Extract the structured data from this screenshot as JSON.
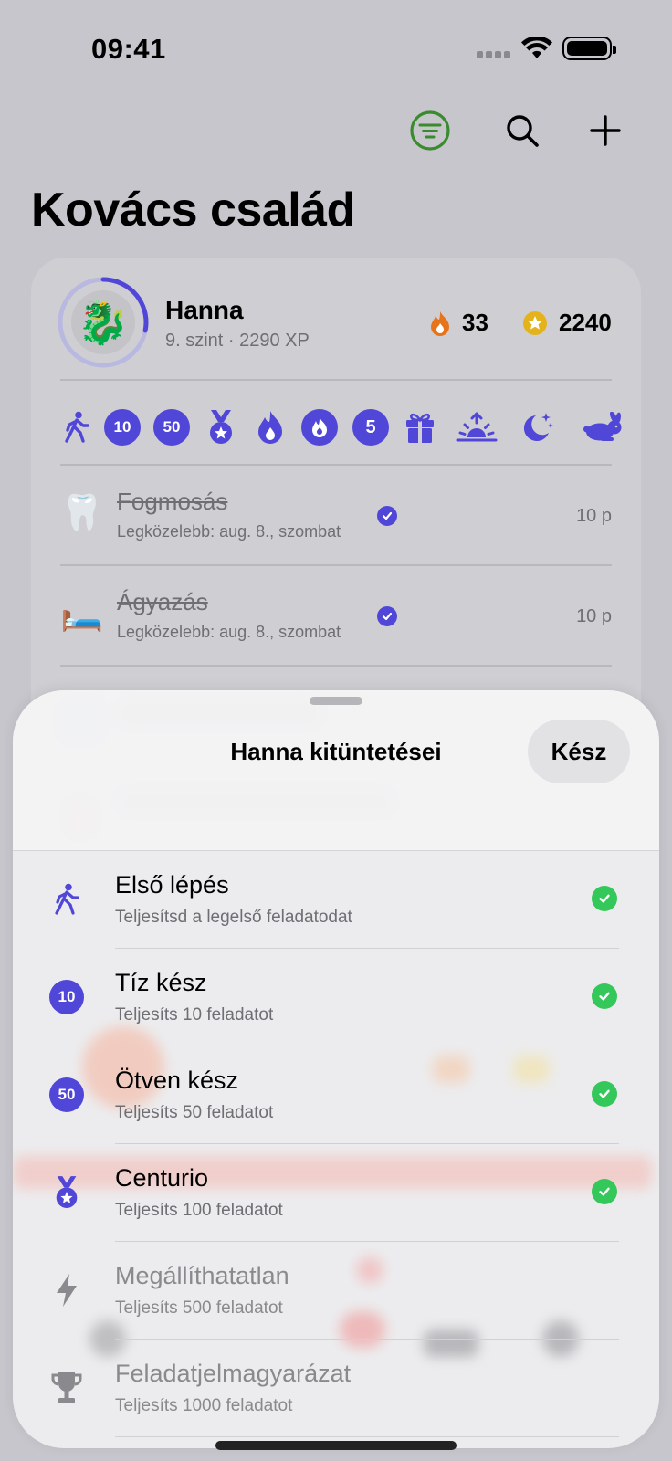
{
  "status_bar": {
    "time": "09:41"
  },
  "toolbar": {
    "filter_icon": "filter-circle-icon",
    "search_icon": "search-icon",
    "add_icon": "plus-icon"
  },
  "page": {
    "title": "Kovács család"
  },
  "member": {
    "name": "Hanna",
    "subtitle": "9. szint · 2290 XP",
    "level_progress": 0.28,
    "streak": "33",
    "points": "2240",
    "avatar": "🐉"
  },
  "badges": [
    {
      "icon": "walking-icon",
      "label": ""
    },
    {
      "icon": "ten-badge-icon",
      "label": "10"
    },
    {
      "icon": "fifty-badge-icon",
      "label": "50"
    },
    {
      "icon": "medal-icon",
      "label": ""
    },
    {
      "icon": "flame-icon",
      "label": ""
    },
    {
      "icon": "flame-circle-icon",
      "label": ""
    },
    {
      "icon": "five-badge-icon",
      "label": "5"
    },
    {
      "icon": "gift-icon",
      "label": ""
    },
    {
      "icon": "sunrise-icon",
      "label": ""
    },
    {
      "icon": "moon-stars-icon",
      "label": ""
    },
    {
      "icon": "rabbit-icon",
      "label": ""
    }
  ],
  "tasks": [
    {
      "emoji": "🦷",
      "name": "Fogmosás",
      "due": "Legközelebb: aug. 8., szombat",
      "points": "10 p",
      "done": true
    },
    {
      "emoji": "🛏️",
      "name": "Ágyazás",
      "due": "Legközelebb: aug. 8., szombat",
      "points": "10 p",
      "done": true
    }
  ],
  "sheet": {
    "title": "Hanna kitüntetései",
    "done_label": "Kész",
    "items": [
      {
        "icon": "walking-icon",
        "badge_text": "",
        "title": "Első lépés",
        "subtitle": "Teljesítsd a legelső feladatodat",
        "earned": true
      },
      {
        "icon": "ten-badge-icon",
        "badge_text": "10",
        "title": "Tíz kész",
        "subtitle": "Teljesíts 10 feladatot",
        "earned": true
      },
      {
        "icon": "fifty-badge-icon",
        "badge_text": "50",
        "title": "Ötven kész",
        "subtitle": "Teljesíts 50 feladatot",
        "earned": true
      },
      {
        "icon": "medal-icon",
        "badge_text": "",
        "title": "Centurio",
        "subtitle": "Teljesíts 100 feladatot",
        "earned": true
      },
      {
        "icon": "bolt-icon",
        "badge_text": "",
        "title": "Megállíthatatlan",
        "subtitle": "Teljesíts 500 feladatot",
        "earned": false
      },
      {
        "icon": "trophy-icon",
        "badge_text": "",
        "title": "Feladatjelmagyarázat",
        "subtitle": "Teljesíts 1000 feladatot",
        "earned": false
      }
    ]
  },
  "colors": {
    "accent": "#5046d8",
    "filter_green": "#3a8a2e",
    "earned_green": "#34c759",
    "streak_orange": "#e8741a",
    "coin_gold": "#e4b31c"
  }
}
